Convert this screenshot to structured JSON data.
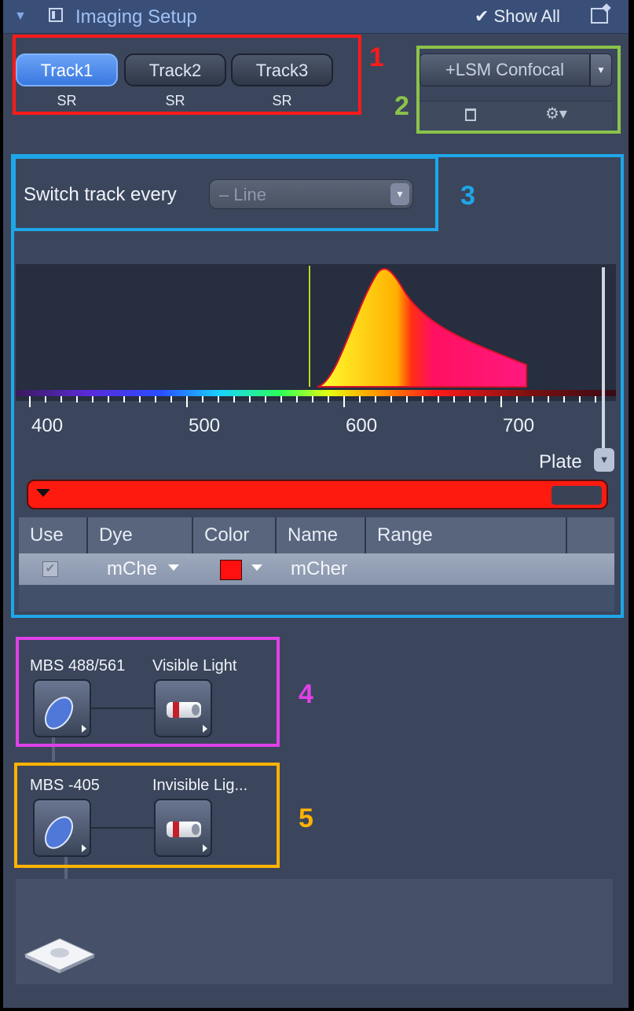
{
  "header": {
    "title": "Imaging Setup",
    "show_all": "✔ Show All"
  },
  "tracks": [
    {
      "label": "Track1",
      "sub": "SR"
    },
    {
      "label": "Track2",
      "sub": "SR"
    },
    {
      "label": "Track3",
      "sub": "SR"
    }
  ],
  "lsm": {
    "label": "+LSM Confocal"
  },
  "switch_track": {
    "label": "Switch track every",
    "value": "– Line"
  },
  "spectrum": {
    "axis_ticks": [
      "400",
      "500",
      "600",
      "700"
    ]
  },
  "plate": {
    "label": "Plate"
  },
  "dye_table": {
    "headers": [
      "Use",
      "Dye",
      "Color",
      "Name",
      "Range"
    ],
    "row": {
      "dye": "mChe",
      "color": "#ff1010",
      "name": "mCher"
    }
  },
  "light_path": [
    {
      "left_label": "MBS 488/561",
      "right_label": "Visible Light"
    },
    {
      "left_label": "MBS -405",
      "right_label": "Invisible Lig..."
    }
  ],
  "annotations": [
    {
      "number": "1",
      "color": "#ff1a1a"
    },
    {
      "number": "2",
      "color": "#8bc34a"
    },
    {
      "number": "3",
      "color": "#1ea7e8"
    },
    {
      "number": "4",
      "color": "#e040e8"
    },
    {
      "number": "5",
      "color": "#ffb300"
    }
  ]
}
